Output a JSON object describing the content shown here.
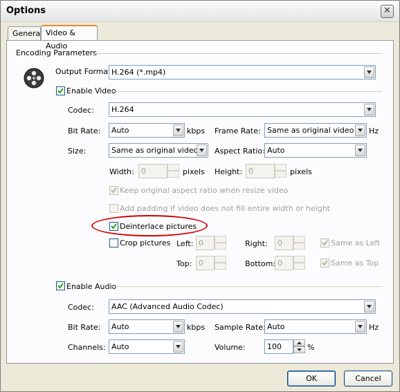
{
  "window": {
    "title": "Options",
    "close_icon": "close-icon"
  },
  "tabs": [
    {
      "label": "General"
    },
    {
      "label": "Video & Audio",
      "active": true
    }
  ],
  "encoding": {
    "group_label": "Encoding Parameters",
    "output_format_label": "Output Format:",
    "output_format_value": "H.264 (*.mp4)"
  },
  "video": {
    "enable_label": "Enable Video",
    "enabled": true,
    "codec_label": "Codec:",
    "codec_value": "H.264",
    "bitrate_label": "Bit Rate:",
    "bitrate_value": "Auto",
    "bitrate_unit": "kbps",
    "framerate_label": "Frame Rate:",
    "framerate_value": "Same as original video",
    "framerate_unit": "Hz",
    "size_label": "Size:",
    "size_value": "Same as original video",
    "aspect_label": "Aspect Ratio:",
    "aspect_value": "Auto",
    "width_label": "Width:",
    "width_value": "0",
    "width_unit": "pixels",
    "height_label": "Height:",
    "height_value": "0",
    "height_unit": "pixels",
    "keep_aspect_label": "Keep original aspect ratio when resize video",
    "keep_aspect_checked": true,
    "padding_label": "Add padding if video does not fill entire width or height",
    "padding_checked": false,
    "deinterlace_label": "Deinterlace pictures",
    "deinterlace_checked": true,
    "crop_label": "Crop pictures",
    "crop_checked": false,
    "left_label": "Left:",
    "left_value": "0",
    "right_label": "Right:",
    "right_value": "0",
    "same_as_left_label": "Same as Left",
    "top_label": "Top:",
    "top_value": "0",
    "bottom_label": "Bottom:",
    "bottom_value": "0",
    "same_as_top_label": "Same as Top"
  },
  "audio": {
    "enable_label": "Enable Audio",
    "enabled": true,
    "codec_label": "Codec:",
    "codec_value": "AAC (Advanced Audio Codec)",
    "bitrate_label": "Bit Rate:",
    "bitrate_value": "Auto",
    "bitrate_unit": "kbps",
    "samplerate_label": "Sample Rate:",
    "samplerate_value": "Auto",
    "samplerate_unit": "Hz",
    "channels_label": "Channels:",
    "channels_value": "Auto",
    "volume_label": "Volume:",
    "volume_value": "100",
    "volume_unit": "%"
  },
  "buttons": {
    "ok_label": "OK",
    "cancel_label": "Cancel"
  },
  "colors": {
    "highlight_ellipse": "#d40000",
    "tab_accent": "#e68b2c"
  }
}
